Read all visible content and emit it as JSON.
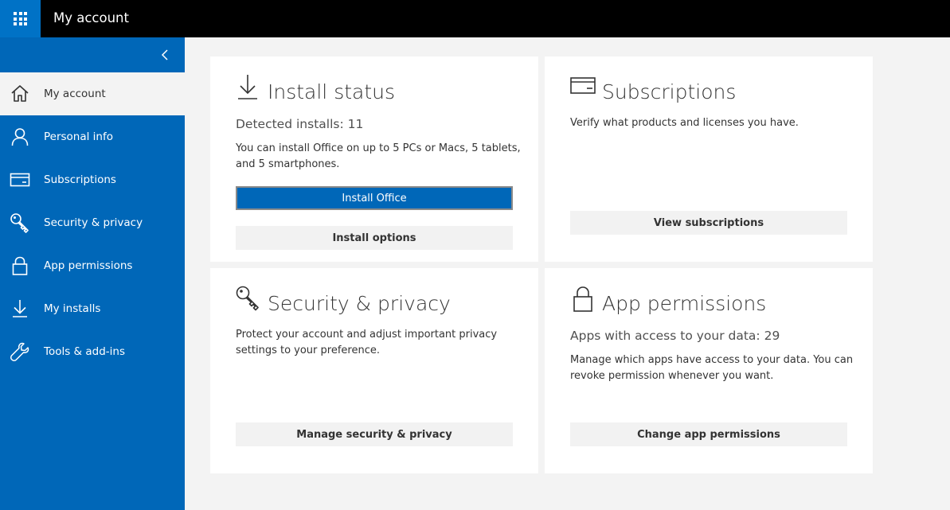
{
  "header": {
    "app_launcher_icon": "waffle-icon",
    "title": "My account"
  },
  "sidebar": {
    "collapse_icon": "chevron-left-icon",
    "items": [
      {
        "label": "My account",
        "icon": "home-icon",
        "active": true
      },
      {
        "label": "Personal info",
        "icon": "person-icon"
      },
      {
        "label": "Subscriptions",
        "icon": "card-icon"
      },
      {
        "label": "Security & privacy",
        "icon": "key-icon"
      },
      {
        "label": "App permissions",
        "icon": "lock-icon"
      },
      {
        "label": "My installs",
        "icon": "download-icon"
      },
      {
        "label": "Tools & add-ins",
        "icon": "wrench-icon"
      }
    ]
  },
  "cards": {
    "install": {
      "icon": "download-icon",
      "title": "Install status",
      "subtitle": "Detected installs: 11",
      "description": "You can install Office on up to 5 PCs or Macs, 5 tablets, and 5 smartphones.",
      "primary_button": "Install Office",
      "secondary_button": "Install options"
    },
    "subscriptions": {
      "icon": "card-icon",
      "title": "Subscriptions",
      "description": "Verify what products and licenses you have.",
      "button": "View subscriptions"
    },
    "security": {
      "icon": "key-icon",
      "title": "Security & privacy",
      "description": "Protect your account and adjust important privacy settings to your preference.",
      "button": "Manage security & privacy"
    },
    "permissions": {
      "icon": "lock-icon",
      "title": "App permissions",
      "subtitle": "Apps with access to your data: 29",
      "description": "Manage which apps have access to your data. You can revoke permission whenever you want.",
      "button": "Change app permissions"
    }
  },
  "colors": {
    "accent": "#0067b8",
    "launcher": "#0072c6",
    "topbar": "#000000",
    "page_background": "#f3f3f3"
  }
}
